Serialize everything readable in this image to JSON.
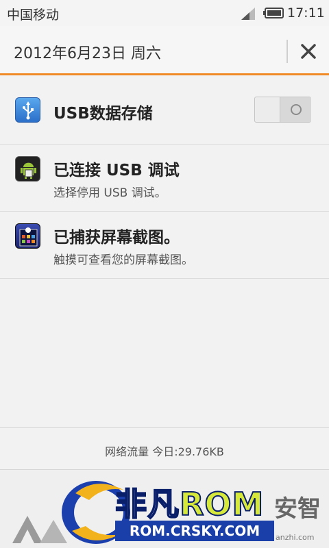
{
  "status_bar": {
    "carrier": "中国移动",
    "time": "17:11"
  },
  "header": {
    "date": "2012年6月23日 周六"
  },
  "notifications": [
    {
      "title": "USB数据存储",
      "subtitle": "",
      "icon": "usb-icon"
    },
    {
      "title": "已连接 USB 调试",
      "subtitle": "选择停用 USB 调试。",
      "icon": "android-debug-icon"
    },
    {
      "title": "已捕获屏幕截图。",
      "subtitle": "触摸可查看您的屏幕截图。",
      "icon": "screenshot-icon"
    }
  ],
  "traffic": {
    "text": "网络流量  今日:29.76KB"
  },
  "watermark": {
    "brand_prefix": "非凡",
    "brand_suffix": "ROM",
    "url": "ROM.CRSKY.COM",
    "anzhi": "安智",
    "anzhi_url": "anzhi.com"
  },
  "colors": {
    "accent": "#f08a24",
    "background": "#f2f2f2"
  }
}
